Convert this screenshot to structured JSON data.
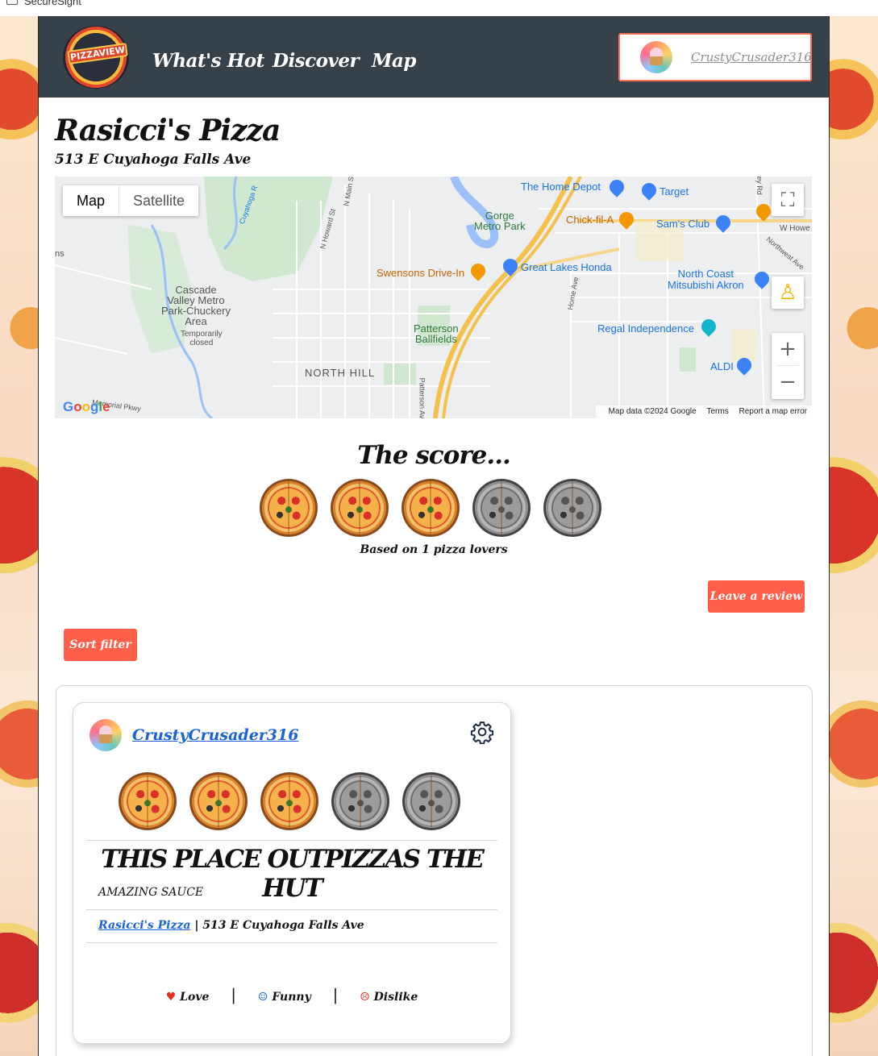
{
  "browser": {
    "tab_title": "SecureSight"
  },
  "nav": {
    "logo_text": "PIZZAVIEW",
    "links": [
      "What's Hot",
      "Discover",
      "Map"
    ],
    "username": "CrustyCrusader316"
  },
  "restaurant": {
    "name": "Rasicci's Pizza",
    "address": "513 E Cuyahoga Falls Ave"
  },
  "map": {
    "tabs": [
      "Map",
      "Satellite"
    ],
    "active_tab": "Map",
    "labels": {
      "home_depot": "The Home Depot",
      "target": "Target",
      "gorge_park": "Gorge\nMetro Park",
      "chick_fil_a": "Chick-fil-A",
      "sams_club": "Sam's Club",
      "w_howe": "W Howe",
      "swensons": "Swensons Drive-In",
      "great_lakes": "Great Lakes Honda",
      "north_coast": "North Coast\nMitsubishi Akron",
      "cascade": "Cascade\nValley Metro\nPark-Chuckery\nArea",
      "temp_closed": "Temporarily\nclosed",
      "patterson": "Patterson\nBallfields",
      "regal": "Regal Independence",
      "north_hill": "NORTH HILL",
      "aldi": "ALDI",
      "memorial": "Memorial Pkwy",
      "cuyahoga_river": "Cuyahoga R",
      "n_howard": "N Howard St",
      "n_main": "N Main St",
      "home_ave": "Home Ave",
      "northwest_ave": "Northwest Ave",
      "patterson_ave": "Patterson Av",
      "edge_left": "ns",
      "red_rd": "ey Rd"
    },
    "footer": {
      "data": "Map data ©2024 Google",
      "terms": "Terms",
      "report": "Report a map error"
    },
    "google": "Google"
  },
  "score": {
    "title": "The score...",
    "rating": 3,
    "max": 5,
    "based_on": "Based on 1 pizza lovers"
  },
  "buttons": {
    "leave_review": "Leave a review",
    "sort_filter": "Sort filter"
  },
  "review": {
    "user": "CrustyCrusader316",
    "rating": 3,
    "max": 5,
    "title": "THIS PLACE OUTPIZZAS THE HUT",
    "body": "AMAZING SAUCE",
    "place_link": "Rasicci's Pizza",
    "place_address": "513 E Cuyahoga Falls Ave",
    "reactions": {
      "love": "Love",
      "funny": "Funny",
      "dislike": "Dislike",
      "separator": "|"
    }
  },
  "colors": {
    "nav_bg": "#36414a",
    "accent": "#ff5e48",
    "link": "#1a62d6"
  },
  "icons": {
    "settings": "gear-icon",
    "love": "heart-icon",
    "funny": "smile-icon",
    "dislike": "frown-icon"
  }
}
